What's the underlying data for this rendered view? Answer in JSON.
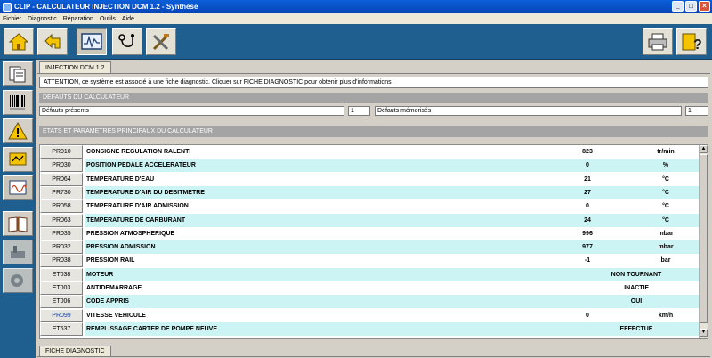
{
  "window": {
    "title": "CLIP - CALCULATEUR INJECTION DCM 1.2 - Synthèse",
    "minimize": "_",
    "maximize": "□",
    "close": "×"
  },
  "menu": [
    "Fichier",
    "Diagnostic",
    "Réparation",
    "Outils",
    "Aide"
  ],
  "toolbar": {
    "icons": [
      "home-icon",
      "back-icon",
      "oscilloscope-icon",
      "multimeter-icon",
      "tools-icon",
      "printer-icon",
      "help-icon"
    ],
    "help_glyph": "?"
  },
  "sidebar": {
    "icons": [
      "identification-icon",
      "barcode-icon",
      "warning-icon",
      "status-icon",
      "actuator-icon",
      "parameters-icon",
      "documentation-icon",
      "repair-icon",
      "special-functions-icon"
    ]
  },
  "tab": {
    "label": "INJECTION DCM 1.2"
  },
  "notice": "ATTENTION, ce système est associé à une fiche diagnostic. Cliquer sur FICHE DIAGNOSTIC pour obtenir plus d'informations.",
  "faults": {
    "header": "DEFAUTS DU CALCULATEUR",
    "present_label": "Défauts présents",
    "present_count": "1",
    "stored_label": "Défauts mémorisés",
    "stored_count": "1"
  },
  "params": {
    "header": "ETATS ET PARAMETRES PRINCIPAUX DU CALCULATEUR",
    "rows": [
      {
        "code": "PR010",
        "label": "CONSIGNE REGULATION RALENTI",
        "value": "823",
        "unit": "tr/min"
      },
      {
        "code": "PR030",
        "label": "POSITION PEDALE ACCELERATEUR",
        "value": "0",
        "unit": "%"
      },
      {
        "code": "PR064",
        "label": "TEMPERATURE D'EAU",
        "value": "21",
        "unit": "°C"
      },
      {
        "code": "PR730",
        "label": "TEMPERATURE D'AIR DU DEBITMETRE",
        "value": "27",
        "unit": "°C"
      },
      {
        "code": "PR058",
        "label": "TEMPERATURE D'AIR ADMISSION",
        "value": "0",
        "unit": "°C"
      },
      {
        "code": "PR063",
        "label": "TEMPERATURE DE CARBURANT",
        "value": "24",
        "unit": "°C"
      },
      {
        "code": "PR035",
        "label": "PRESSION ATMOSPHERIQUE",
        "value": "996",
        "unit": "mbar"
      },
      {
        "code": "PR032",
        "label": "PRESSION ADMISSION",
        "value": "977",
        "unit": "mbar"
      },
      {
        "code": "PR038",
        "label": "PRESSION RAIL",
        "value": "-1",
        "unit": "bar"
      },
      {
        "code": "ET038",
        "label": "MOTEUR",
        "status": "NON TOURNANT"
      },
      {
        "code": "ET003",
        "label": "ANTIDEMARRAGE",
        "status": "INACTIF"
      },
      {
        "code": "ET006",
        "label": "CODE APPRIS",
        "status": "OUI"
      },
      {
        "code": "PR099",
        "label": "VITESSE VEHICULE",
        "value": "0",
        "unit": "km/h",
        "link": true
      },
      {
        "code": "ET637",
        "label": "REMPLISSAGE CARTER DE POMPE NEUVE",
        "status": "EFFECTUE"
      }
    ]
  },
  "bottom_tab": {
    "label": "FICHE DIAGNOSTIC"
  }
}
